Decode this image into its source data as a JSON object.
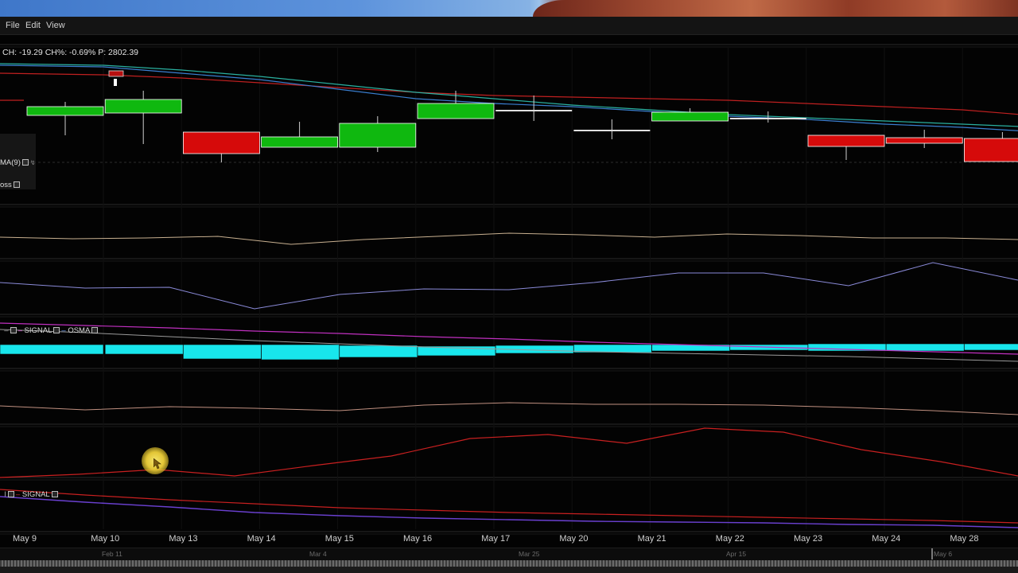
{
  "menu": {
    "file": "File",
    "edit": "Edit",
    "view": "View"
  },
  "info_line": "CH: -19.29 CH%: -0.69% P: 2802.39",
  "legends": {
    "ma": "MA(9)",
    "cross": "oss",
    "macd_signal": "SIGNAL",
    "macd_osma": "OSMA",
    "bottom_signal": "SIGNAL"
  },
  "x_axis": {
    "labels": [
      "May 9",
      "May 10",
      "May 13",
      "May 14",
      "May 15",
      "May 16",
      "May 17",
      "May 20",
      "May 21",
      "May 22",
      "May 23",
      "May 24",
      "May 28"
    ]
  },
  "navigator": {
    "labels": [
      "Feb 11",
      "Mar 4",
      "Mar 25",
      "Apr 15",
      "May 6"
    ]
  },
  "colors": {
    "up": "#0fb80f",
    "down": "#d60a0a",
    "ma_blue": "#3a7fd0",
    "ma_teal": "#2ab0a0",
    "ma_red": "#c02020",
    "osma": "#18e6ec",
    "signal_magenta": "#c030c0",
    "rsi": "#c8b090",
    "stoch": "#8a8ad8",
    "red_line": "#c82020",
    "purple": "#6a40d0"
  },
  "chart_data": {
    "type": "candlestick",
    "x": [
      "May 9",
      "May 10",
      "May 13",
      "May 14",
      "May 15",
      "May 16",
      "May 17",
      "May 20",
      "May 21",
      "May 22",
      "May 23",
      "May 24",
      "May 28"
    ],
    "candles": [
      {
        "date": "May 9",
        "dir": "up"
      },
      {
        "date": "May 10",
        "dir": "up"
      },
      {
        "date": "May 13",
        "dir": "down"
      },
      {
        "date": "May 14",
        "dir": "up"
      },
      {
        "date": "May 15",
        "dir": "up"
      },
      {
        "date": "May 16",
        "dir": "up"
      },
      {
        "date": "May 17",
        "dir": "doji"
      },
      {
        "date": "May 20",
        "dir": "doji"
      },
      {
        "date": "May 21",
        "dir": "up"
      },
      {
        "date": "May 22",
        "dir": "doji"
      },
      {
        "date": "May 23",
        "dir": "down"
      },
      {
        "date": "May 24",
        "dir": "down"
      },
      {
        "date": "May 28",
        "dir": "down"
      }
    ]
  }
}
